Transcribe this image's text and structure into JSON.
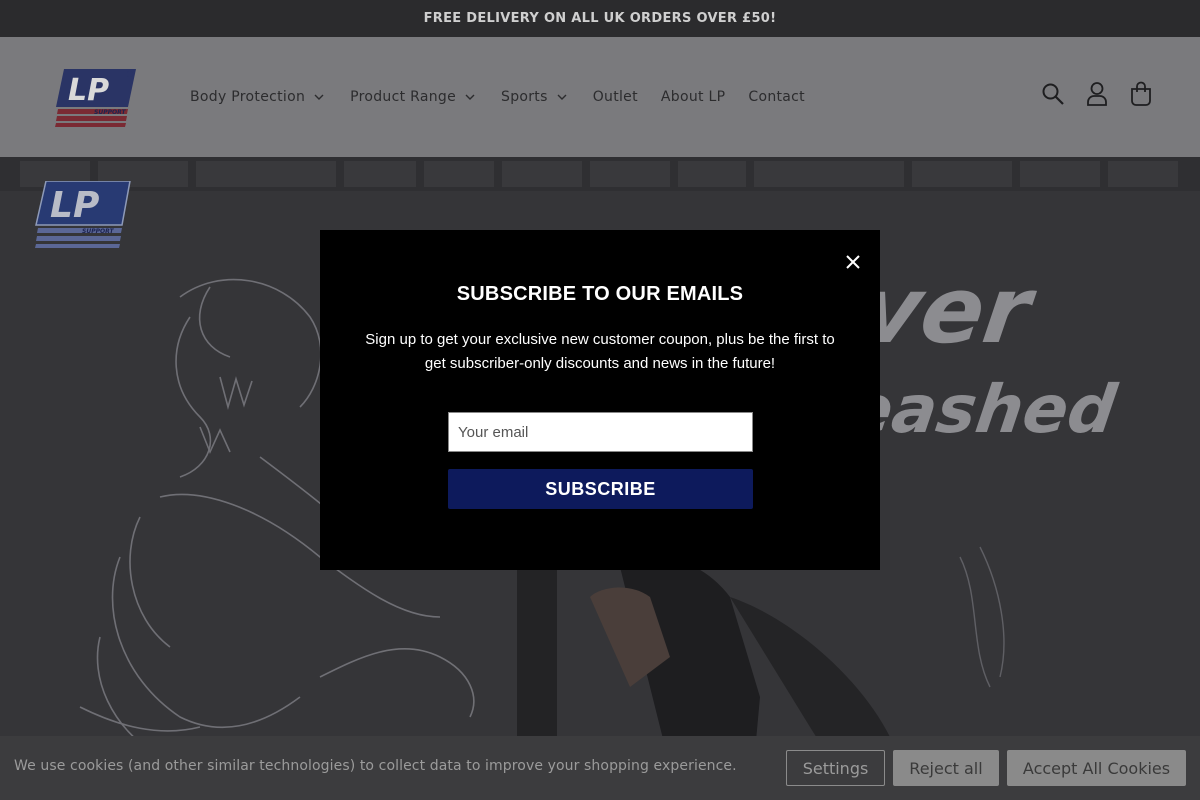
{
  "announcement": {
    "text": "FREE DELIVERY ON ALL UK ORDERS OVER £50!"
  },
  "header": {
    "logo_text": "LP",
    "logo_subtext": "SUPPORT",
    "nav": [
      {
        "label": "Body Protection",
        "has_dropdown": true
      },
      {
        "label": "Product Range",
        "has_dropdown": true
      },
      {
        "label": "Sports",
        "has_dropdown": true
      },
      {
        "label": "Outlet",
        "has_dropdown": false
      },
      {
        "label": "About LP",
        "has_dropdown": false
      },
      {
        "label": "Contact",
        "has_dropdown": false
      }
    ],
    "icons": [
      "search-icon",
      "account-icon",
      "cart-icon"
    ]
  },
  "hero": {
    "logo_text": "LP",
    "logo_subtext": "SUPPORT",
    "headline_line1": "ver",
    "headline_line2": "eashed"
  },
  "modal": {
    "title": "SUBSCRIBE TO OUR EMAILS",
    "description": "Sign up to get your exclusive new customer coupon, plus be the first to get subscriber-only discounts and news in the future!",
    "email_placeholder": "Your email",
    "subscribe_label": "SUBSCRIBE",
    "close_icon": "close-icon"
  },
  "cookie": {
    "text": "We use cookies (and other similar technologies) to collect data to improve your shopping experience.",
    "settings_label": "Settings",
    "reject_label": "Reject all",
    "accept_label": "Accept All Cookies"
  },
  "colors": {
    "accent_navy": "#0d1a5c",
    "logo_blue": "#1f2f8a",
    "logo_red": "#c8102e",
    "overlay_dim": "#7a7a7d"
  }
}
